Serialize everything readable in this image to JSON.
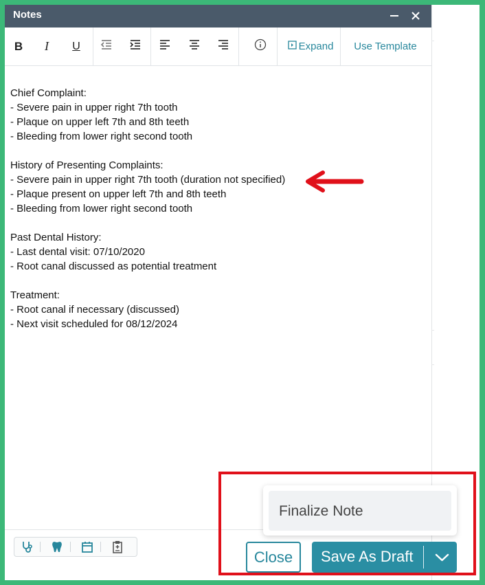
{
  "window": {
    "title": "Notes",
    "minimize_icon": "minimize-icon",
    "close_icon": "close-icon"
  },
  "toolbar": {
    "bold": "B",
    "italic": "I",
    "underline": "U",
    "info_icon": "info-icon",
    "expand_label": "Expand",
    "template_label": "Use Template"
  },
  "note": {
    "lines": [
      "Chief Complaint:",
      "- Severe pain in upper right 7th tooth",
      "- Plaque on upper left 7th and 8th teeth",
      "- Bleeding from lower right second tooth",
      "",
      "History of Presenting Complaints:",
      "- Severe pain in upper right 7th tooth (duration not specified)",
      "- Plaque present on upper left 7th and 8th teeth",
      "- Bleeding from lower right second tooth",
      "",
      "Past Dental History:",
      "- Last dental visit: 07/10/2020",
      "- Root canal discussed as potential treatment",
      "",
      "Treatment:",
      "- Root canal if necessary (discussed)",
      "- Next visit scheduled for 08/12/2024"
    ]
  },
  "bottom_icons": [
    "stethoscope-icon",
    "tooth-icon",
    "calendar-icon",
    "clipboard-icon"
  ],
  "actions": {
    "menu_item": "Finalize Note",
    "close_label": "Close",
    "save_label": "Save As Draft"
  },
  "colors": {
    "accent": "#2a8ea3",
    "titlebar": "#4a5a6a",
    "annotation": "#e0101a",
    "outer_border": "#3cb878"
  }
}
